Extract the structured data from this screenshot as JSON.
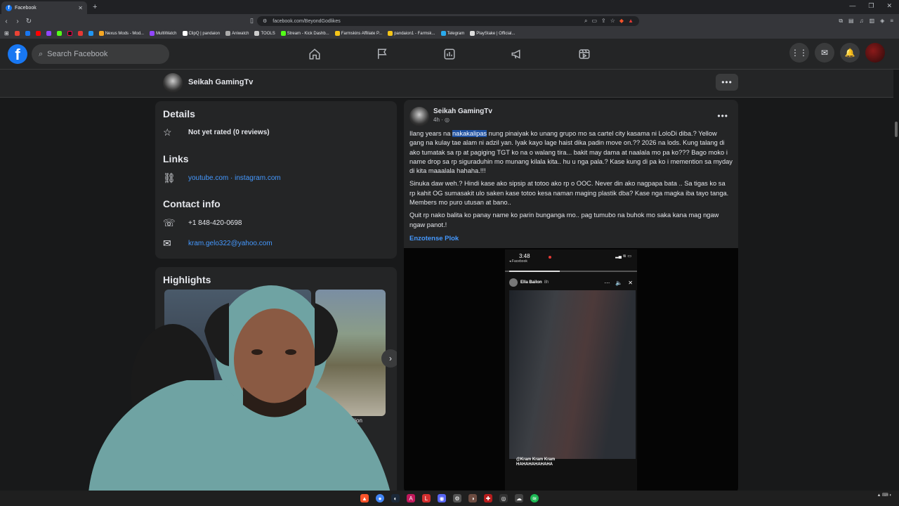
{
  "browser": {
    "tab_title": "Facebook",
    "url": "facebook.com/BeyondGodlikes",
    "new_tab": "+",
    "bookmarks": [
      "Nexus Mods - Mod...",
      "MultiWatch",
      "ClipQ | pandaion",
      "Aniwatch",
      "TOOLS",
      "Stream - Kick Dashb...",
      "Farmskins Affiliate P...",
      "pandaion1 - Farmsk...",
      "Telegram",
      "PlayStake | Official..."
    ]
  },
  "header": {
    "search_placeholder": "Search Facebook"
  },
  "page": {
    "name": "Seikah GamingTv",
    "more": "•••"
  },
  "details": {
    "title": "Details",
    "rating": "Not yet rated (0 reviews)",
    "links_title": "Links",
    "links": "youtube.com · instagram.com",
    "contact_title": "Contact info",
    "phone": "+1 848-420-0698",
    "email": "kram.gelo322@yahoo.com"
  },
  "highlights": {
    "title": "Highlights",
    "caption": "ction"
  },
  "post": {
    "author": "Seikah GamingTv",
    "time": "4h · ",
    "more": "•••",
    "p1_before": "Ilang years na ",
    "p1_highlight": "nakakalipas",
    "p1_after": " nung pinaiyak ko unang grupo mo sa cartel  city kasama ni LoloDi diba.? Yellow gang na kulay tae alam ni adzil yan. Iyak kayo lage haist dika padin move on.?? 2026 na lods. Kung talang di ako tumatak sa rp at pagiging TGT ko na o walang tira... bakit may dama at naalala mo pa ko??? Bago moko i name drop sa rp siguraduhin mo munang kilala kita.. hu u nga pala.? Kase kung di pa ko i memention sa myday di kita maaalala hahaha.!!!",
    "p2": "Sinuka daw weh.? Hindi kase ako sipsip at totoo ako rp o OOC. Never din ako nagpapa bata .. Sa tigas ko sa rp kahit OG sumasakit ulo saken kase totoo kesa naman maging plastik dba? Kase nga magka iba tayo tanga. Members mo puro  utusan at bano..",
    "p3": "Quit rp nako balita ko panay name ko parin bunganga mo.. pag tumubo na buhok mo saka kana mag ngaw ngaw panot.!",
    "tag": "Enzotense Plok"
  },
  "story": {
    "time": "3:48",
    "app": "◂ Facebook",
    "user": "Ella Bailon",
    "ago": "8h",
    "caption_line1": "@Kram Kram Kram",
    "caption_line2": "HAHAHAHAHAHA"
  },
  "colors": {
    "fb_blue": "#1877f2",
    "link": "#4599ff",
    "bg": "#18191a",
    "card": "#242526"
  }
}
